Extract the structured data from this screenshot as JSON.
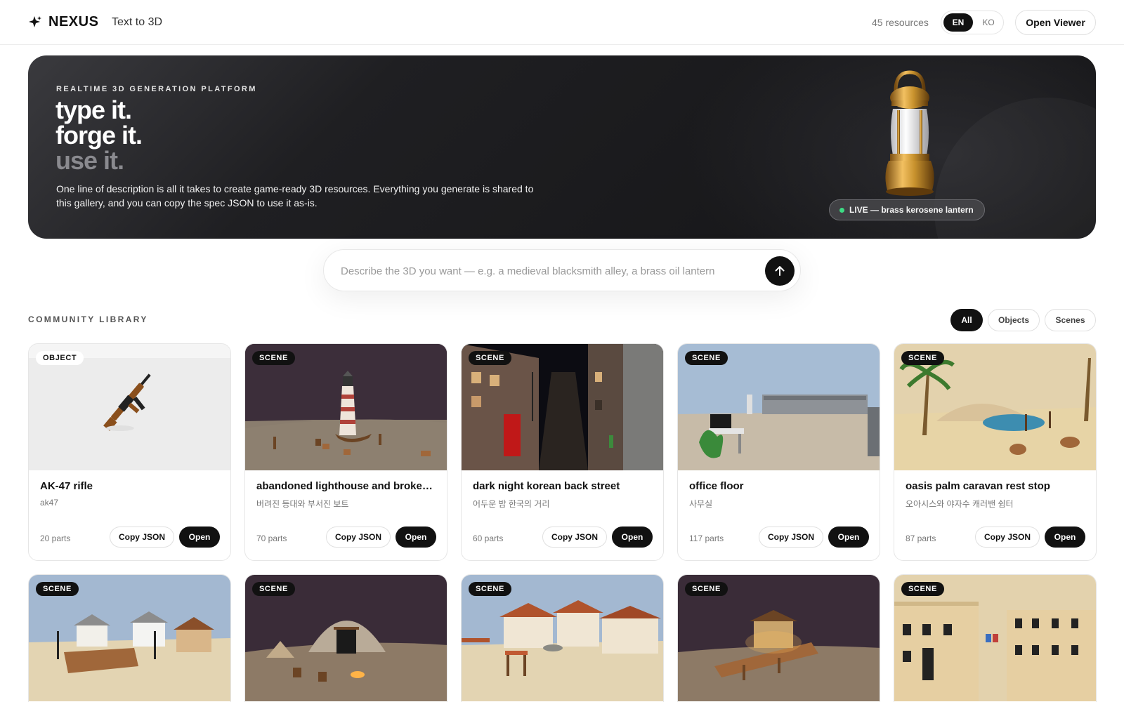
{
  "header": {
    "brand": "NEXUS",
    "tagline": "Text to 3D",
    "resource_count": "45 resources",
    "lang_en": "EN",
    "lang_ko": "KO",
    "open_viewer": "Open Viewer"
  },
  "hero": {
    "eyebrow": "REALTIME 3D GENERATION PLATFORM",
    "line1": "type it.",
    "line2": "forge it.",
    "line3": "use it.",
    "description": "One line of description is all it takes to create game-ready 3D resources. Everything you generate is shared to this gallery, and you can copy the spec JSON to use it as-is.",
    "live_label": "LIVE — brass kerosene lantern"
  },
  "search": {
    "placeholder": "Describe the 3D you want — e.g. a medieval blacksmith alley, a brass oil lantern",
    "send_icon": "arrow-up-icon"
  },
  "library": {
    "title": "COMMUNITY LIBRARY",
    "filters": {
      "all": "All",
      "objects": "Objects",
      "scenes": "Scenes"
    },
    "copy_label": "Copy JSON",
    "open_label": "Open",
    "cards": [
      {
        "badge": "OBJECT",
        "title": "AK-47 rifle",
        "subtitle": "ak47",
        "parts": "20 parts"
      },
      {
        "badge": "SCENE",
        "title": "abandoned lighthouse and broken boat",
        "subtitle": "버려진 등대와 부서진 보트",
        "parts": "70 parts"
      },
      {
        "badge": "SCENE",
        "title": "dark night korean back street",
        "subtitle": "어두운 밤 한국의 거리",
        "parts": "60 parts"
      },
      {
        "badge": "SCENE",
        "title": "office floor",
        "subtitle": "사무실",
        "parts": "117 parts"
      },
      {
        "badge": "SCENE",
        "title": "oasis palm caravan rest stop",
        "subtitle": "오아시스와 야자수 캐러밴 쉼터",
        "parts": "87 parts"
      },
      {
        "badge": "SCENE"
      },
      {
        "badge": "SCENE"
      },
      {
        "badge": "SCENE"
      },
      {
        "badge": "SCENE"
      },
      {
        "badge": "SCENE"
      }
    ]
  },
  "colors": {
    "accent": "#111111",
    "hero_bg": "#1c1c1f",
    "live_dot": "#3ddc84",
    "brass": "#c8922e"
  }
}
